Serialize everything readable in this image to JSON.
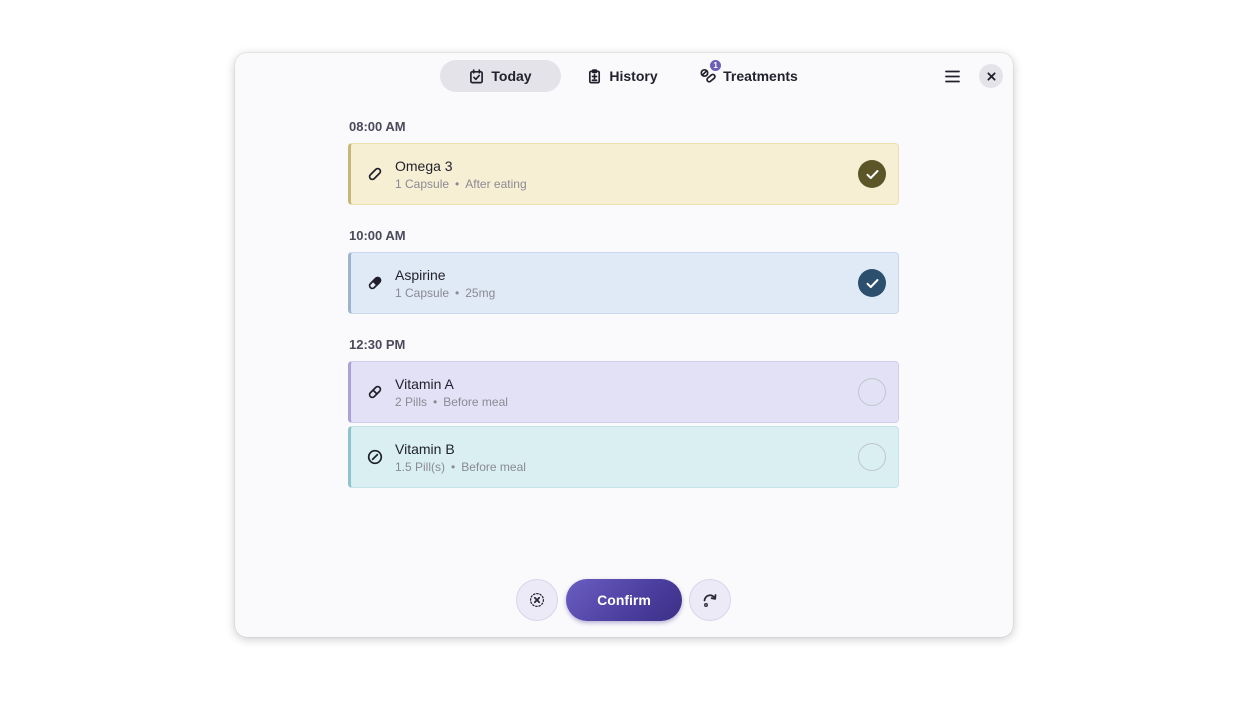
{
  "header": {
    "tabs": [
      {
        "label": "Today",
        "icon": "calendar-check-icon",
        "active": true
      },
      {
        "label": "History",
        "icon": "clipboard-icon",
        "active": false
      },
      {
        "label": "Treatments",
        "icon": "pills-icon",
        "active": false,
        "badge": "1"
      }
    ],
    "menu_icon": "hamburger-menu-icon",
    "close_icon": "close-icon"
  },
  "schedule": [
    {
      "time": "08:00 AM",
      "items": [
        {
          "name": "Omega 3",
          "dose": "1 Capsule",
          "note": "After eating",
          "icon": "capsule-icon",
          "taken": true,
          "bg": "#f6efd3",
          "border": "#ece0b0",
          "accent": "#c9b77a",
          "check": "#5c5528"
        }
      ]
    },
    {
      "time": "10:00 AM",
      "items": [
        {
          "name": "Aspirine",
          "dose": "1 Capsule",
          "note": "25mg",
          "icon": "capsule-half-icon",
          "taken": true,
          "bg": "#e0eaf6",
          "border": "#c9d8ec",
          "accent": "#9db4d0",
          "check": "#2c4f6e"
        }
      ]
    },
    {
      "time": "12:30 PM",
      "items": [
        {
          "name": "Vitamin A",
          "dose": "2 Pills",
          "note": "Before meal",
          "icon": "capsule-outline-icon",
          "taken": false,
          "bg": "#e3e1f5",
          "border": "#d2cfee",
          "accent": "#a9a2d6",
          "check": ""
        },
        {
          "name": "Vitamin B",
          "dose": "1.5 Pill(s)",
          "note": "Before meal",
          "icon": "tablet-icon",
          "taken": false,
          "bg": "#d9eff2",
          "border": "#c3e3e8",
          "accent": "#8fc3cb",
          "check": ""
        }
      ]
    }
  ],
  "footer": {
    "skip_icon": "skip-icon",
    "confirm_label": "Confirm",
    "snooze_icon": "snooze-icon"
  }
}
